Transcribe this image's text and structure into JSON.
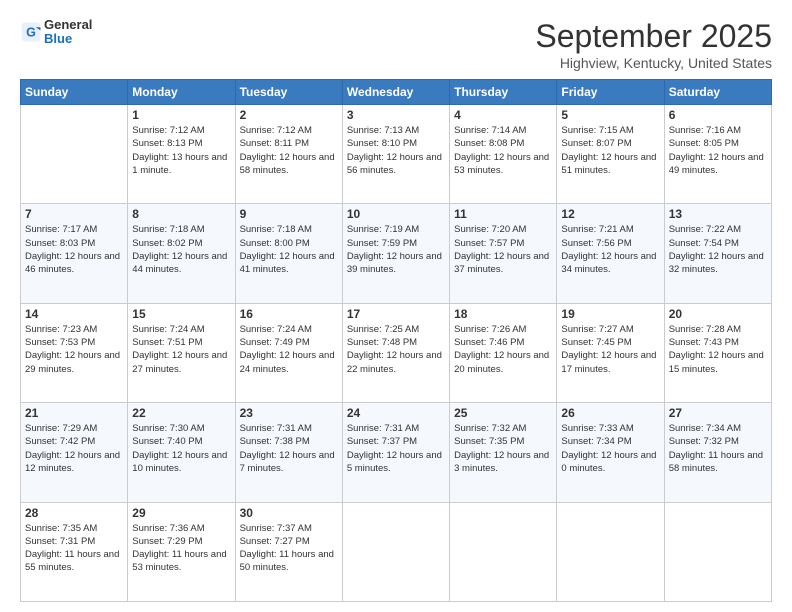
{
  "header": {
    "logo_general": "General",
    "logo_blue": "Blue",
    "title": "September 2025",
    "subtitle": "Highview, Kentucky, United States"
  },
  "days_of_week": [
    "Sunday",
    "Monday",
    "Tuesday",
    "Wednesday",
    "Thursday",
    "Friday",
    "Saturday"
  ],
  "weeks": [
    [
      {
        "day": "",
        "sunrise": "",
        "sunset": "",
        "daylight": ""
      },
      {
        "day": "1",
        "sunrise": "Sunrise: 7:12 AM",
        "sunset": "Sunset: 8:13 PM",
        "daylight": "Daylight: 13 hours and 1 minute."
      },
      {
        "day": "2",
        "sunrise": "Sunrise: 7:12 AM",
        "sunset": "Sunset: 8:11 PM",
        "daylight": "Daylight: 12 hours and 58 minutes."
      },
      {
        "day": "3",
        "sunrise": "Sunrise: 7:13 AM",
        "sunset": "Sunset: 8:10 PM",
        "daylight": "Daylight: 12 hours and 56 minutes."
      },
      {
        "day": "4",
        "sunrise": "Sunrise: 7:14 AM",
        "sunset": "Sunset: 8:08 PM",
        "daylight": "Daylight: 12 hours and 53 minutes."
      },
      {
        "day": "5",
        "sunrise": "Sunrise: 7:15 AM",
        "sunset": "Sunset: 8:07 PM",
        "daylight": "Daylight: 12 hours and 51 minutes."
      },
      {
        "day": "6",
        "sunrise": "Sunrise: 7:16 AM",
        "sunset": "Sunset: 8:05 PM",
        "daylight": "Daylight: 12 hours and 49 minutes."
      }
    ],
    [
      {
        "day": "7",
        "sunrise": "Sunrise: 7:17 AM",
        "sunset": "Sunset: 8:03 PM",
        "daylight": "Daylight: 12 hours and 46 minutes."
      },
      {
        "day": "8",
        "sunrise": "Sunrise: 7:18 AM",
        "sunset": "Sunset: 8:02 PM",
        "daylight": "Daylight: 12 hours and 44 minutes."
      },
      {
        "day": "9",
        "sunrise": "Sunrise: 7:18 AM",
        "sunset": "Sunset: 8:00 PM",
        "daylight": "Daylight: 12 hours and 41 minutes."
      },
      {
        "day": "10",
        "sunrise": "Sunrise: 7:19 AM",
        "sunset": "Sunset: 7:59 PM",
        "daylight": "Daylight: 12 hours and 39 minutes."
      },
      {
        "day": "11",
        "sunrise": "Sunrise: 7:20 AM",
        "sunset": "Sunset: 7:57 PM",
        "daylight": "Daylight: 12 hours and 37 minutes."
      },
      {
        "day": "12",
        "sunrise": "Sunrise: 7:21 AM",
        "sunset": "Sunset: 7:56 PM",
        "daylight": "Daylight: 12 hours and 34 minutes."
      },
      {
        "day": "13",
        "sunrise": "Sunrise: 7:22 AM",
        "sunset": "Sunset: 7:54 PM",
        "daylight": "Daylight: 12 hours and 32 minutes."
      }
    ],
    [
      {
        "day": "14",
        "sunrise": "Sunrise: 7:23 AM",
        "sunset": "Sunset: 7:53 PM",
        "daylight": "Daylight: 12 hours and 29 minutes."
      },
      {
        "day": "15",
        "sunrise": "Sunrise: 7:24 AM",
        "sunset": "Sunset: 7:51 PM",
        "daylight": "Daylight: 12 hours and 27 minutes."
      },
      {
        "day": "16",
        "sunrise": "Sunrise: 7:24 AM",
        "sunset": "Sunset: 7:49 PM",
        "daylight": "Daylight: 12 hours and 24 minutes."
      },
      {
        "day": "17",
        "sunrise": "Sunrise: 7:25 AM",
        "sunset": "Sunset: 7:48 PM",
        "daylight": "Daylight: 12 hours and 22 minutes."
      },
      {
        "day": "18",
        "sunrise": "Sunrise: 7:26 AM",
        "sunset": "Sunset: 7:46 PM",
        "daylight": "Daylight: 12 hours and 20 minutes."
      },
      {
        "day": "19",
        "sunrise": "Sunrise: 7:27 AM",
        "sunset": "Sunset: 7:45 PM",
        "daylight": "Daylight: 12 hours and 17 minutes."
      },
      {
        "day": "20",
        "sunrise": "Sunrise: 7:28 AM",
        "sunset": "Sunset: 7:43 PM",
        "daylight": "Daylight: 12 hours and 15 minutes."
      }
    ],
    [
      {
        "day": "21",
        "sunrise": "Sunrise: 7:29 AM",
        "sunset": "Sunset: 7:42 PM",
        "daylight": "Daylight: 12 hours and 12 minutes."
      },
      {
        "day": "22",
        "sunrise": "Sunrise: 7:30 AM",
        "sunset": "Sunset: 7:40 PM",
        "daylight": "Daylight: 12 hours and 10 minutes."
      },
      {
        "day": "23",
        "sunrise": "Sunrise: 7:31 AM",
        "sunset": "Sunset: 7:38 PM",
        "daylight": "Daylight: 12 hours and 7 minutes."
      },
      {
        "day": "24",
        "sunrise": "Sunrise: 7:31 AM",
        "sunset": "Sunset: 7:37 PM",
        "daylight": "Daylight: 12 hours and 5 minutes."
      },
      {
        "day": "25",
        "sunrise": "Sunrise: 7:32 AM",
        "sunset": "Sunset: 7:35 PM",
        "daylight": "Daylight: 12 hours and 3 minutes."
      },
      {
        "day": "26",
        "sunrise": "Sunrise: 7:33 AM",
        "sunset": "Sunset: 7:34 PM",
        "daylight": "Daylight: 12 hours and 0 minutes."
      },
      {
        "day": "27",
        "sunrise": "Sunrise: 7:34 AM",
        "sunset": "Sunset: 7:32 PM",
        "daylight": "Daylight: 11 hours and 58 minutes."
      }
    ],
    [
      {
        "day": "28",
        "sunrise": "Sunrise: 7:35 AM",
        "sunset": "Sunset: 7:31 PM",
        "daylight": "Daylight: 11 hours and 55 minutes."
      },
      {
        "day": "29",
        "sunrise": "Sunrise: 7:36 AM",
        "sunset": "Sunset: 7:29 PM",
        "daylight": "Daylight: 11 hours and 53 minutes."
      },
      {
        "day": "30",
        "sunrise": "Sunrise: 7:37 AM",
        "sunset": "Sunset: 7:27 PM",
        "daylight": "Daylight: 11 hours and 50 minutes."
      },
      {
        "day": "",
        "sunrise": "",
        "sunset": "",
        "daylight": ""
      },
      {
        "day": "",
        "sunrise": "",
        "sunset": "",
        "daylight": ""
      },
      {
        "day": "",
        "sunrise": "",
        "sunset": "",
        "daylight": ""
      },
      {
        "day": "",
        "sunrise": "",
        "sunset": "",
        "daylight": ""
      }
    ]
  ]
}
